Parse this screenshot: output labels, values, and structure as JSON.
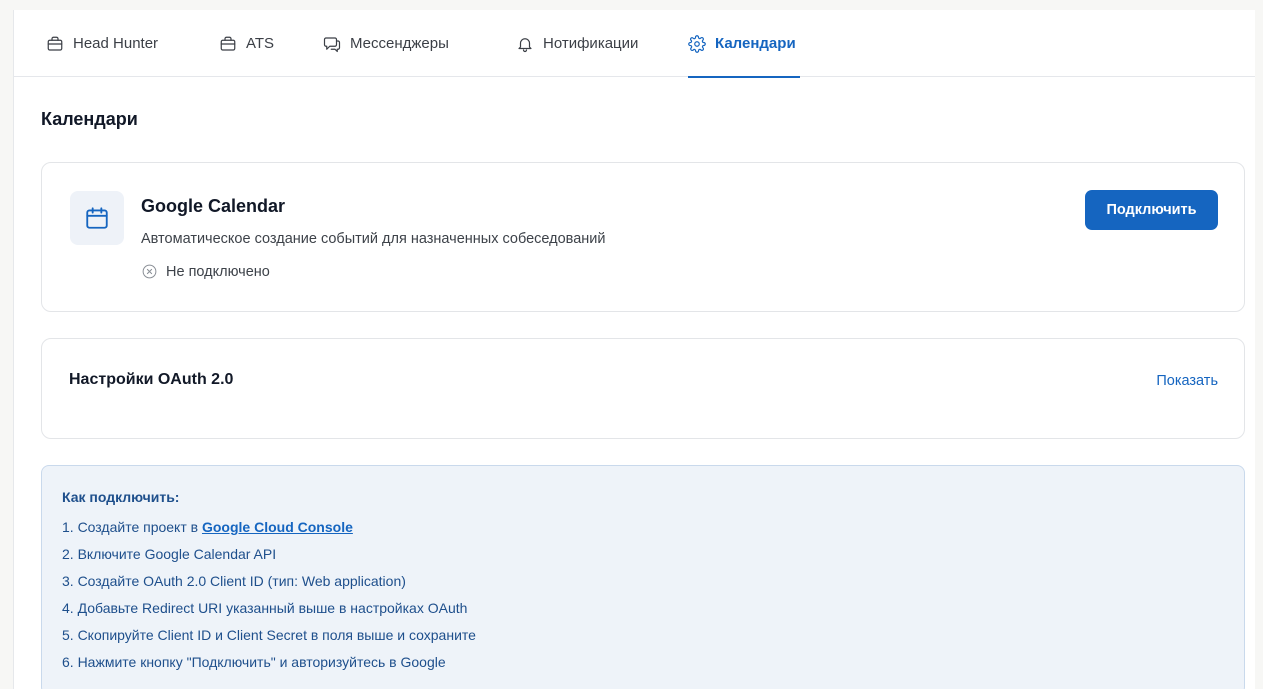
{
  "tabs": [
    {
      "label": "Head Hunter",
      "icon": "briefcase-icon",
      "active": false
    },
    {
      "label": "ATS",
      "icon": "briefcase-icon",
      "active": false
    },
    {
      "label": "Мессенджеры",
      "icon": "chat-bubbles-icon",
      "active": false
    },
    {
      "label": "Нотификации",
      "icon": "bell-icon",
      "active": false
    },
    {
      "label": "Календари",
      "icon": "gear-icon",
      "active": true
    }
  ],
  "page": {
    "title": "Календари"
  },
  "google_calendar": {
    "icon": "calendar-icon",
    "title": "Google Calendar",
    "description": "Автоматическое создание событий для назначенных собеседований",
    "status_icon": "x-circle-icon",
    "status": "Не подключено",
    "connect_label": "Подключить"
  },
  "oauth": {
    "title": "Настройки OAuth 2.0",
    "toggle_label": "Показать"
  },
  "help": {
    "title": "Как подключить:",
    "step1_prefix": "1. Создайте проект в ",
    "step1_link": "Google Cloud Console",
    "steps": [
      "2. Включите Google Calendar API",
      "3. Создайте OAuth 2.0 Client ID (тип: Web application)",
      "4. Добавьте Redirect URI указанный выше в настройках OAuth",
      "5. Скопируйте Client ID и Client Secret в поля выше и сохраните",
      "6. Нажмите кнопку \"Подключить\" и авторизуйтесь в Google"
    ]
  },
  "colors": {
    "accent": "#1565c0",
    "help_background": "#eef3f9",
    "help_text": "#1e4f8c"
  }
}
